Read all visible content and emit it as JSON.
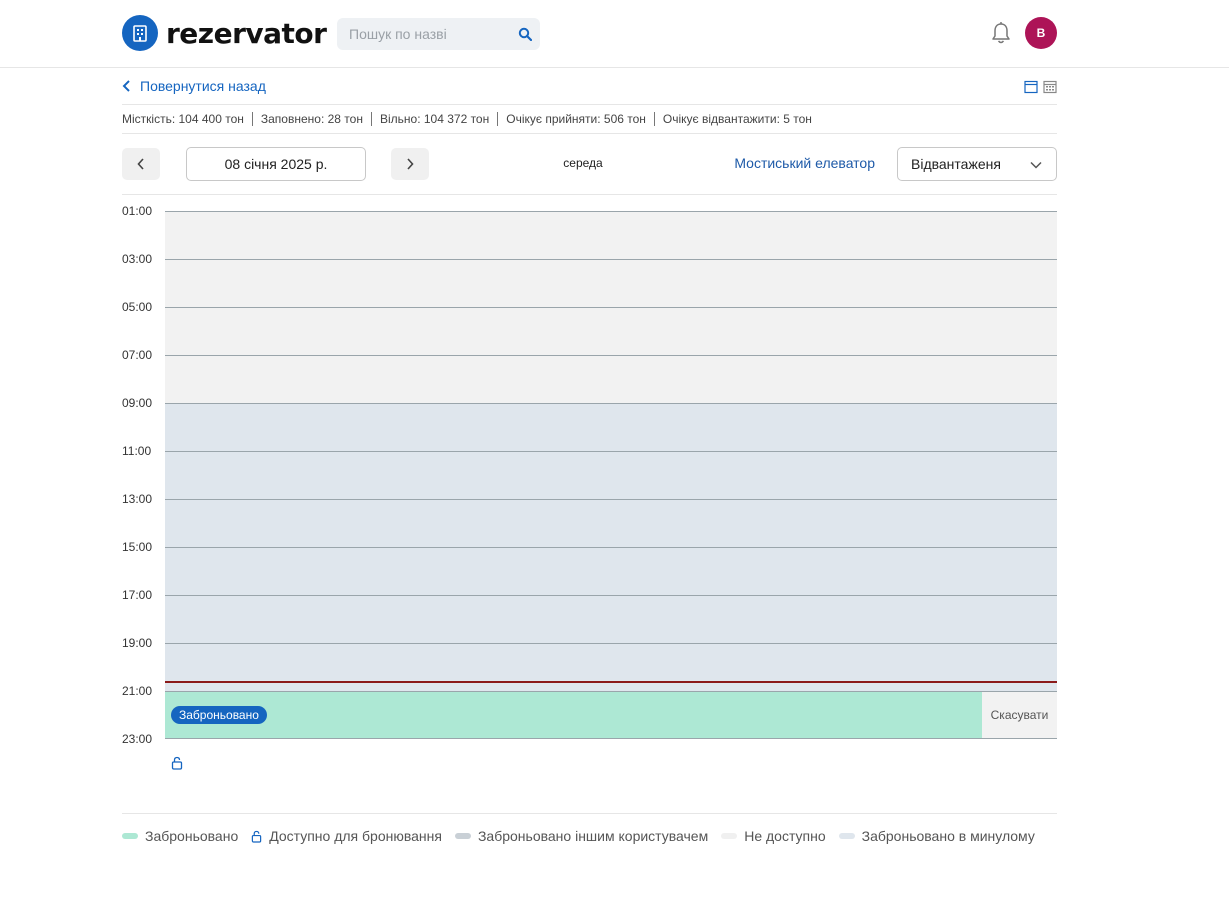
{
  "header": {
    "logo_text": "rezervator",
    "search_placeholder": "Пошук по назві",
    "avatar_initial": "В"
  },
  "back_label": "Повернутися назад",
  "stats": [
    "Місткість: 104 400 тон",
    "Заповнено: 28 тон",
    "Вільно: 104 372 тон",
    "Очікує прийняти: 506 тон",
    "Очікує відвантажити: 5 тон"
  ],
  "date_nav": {
    "date": "08 січня 2025 р.",
    "weekday": "середа",
    "elevator": "Мостиський елеватор",
    "mode": "Відвантаженя"
  },
  "timeline": {
    "hours": [
      "01:00",
      "03:00",
      "05:00",
      "07:00",
      "09:00",
      "11:00",
      "13:00",
      "15:00",
      "17:00",
      "19:00",
      "21:00",
      "23:00"
    ],
    "booked_label": "Заброньовано",
    "cancel_label": "Скасувати"
  },
  "legend": {
    "booked": "Заброньовано",
    "available": "Доступно для бронювання",
    "booked_other": "Заброньовано іншим користувачем",
    "unavailable": "Не доступно",
    "booked_past": "Заброньовано в минулому"
  },
  "colors": {
    "accent": "#1565c0",
    "booked": "#ade8d4",
    "unavailable": "#f2f2f2",
    "past": "#dfe6ed",
    "booked_other": "#c9d0d6",
    "now_line": "#8b1a1a",
    "avatar": "#ad1457"
  }
}
